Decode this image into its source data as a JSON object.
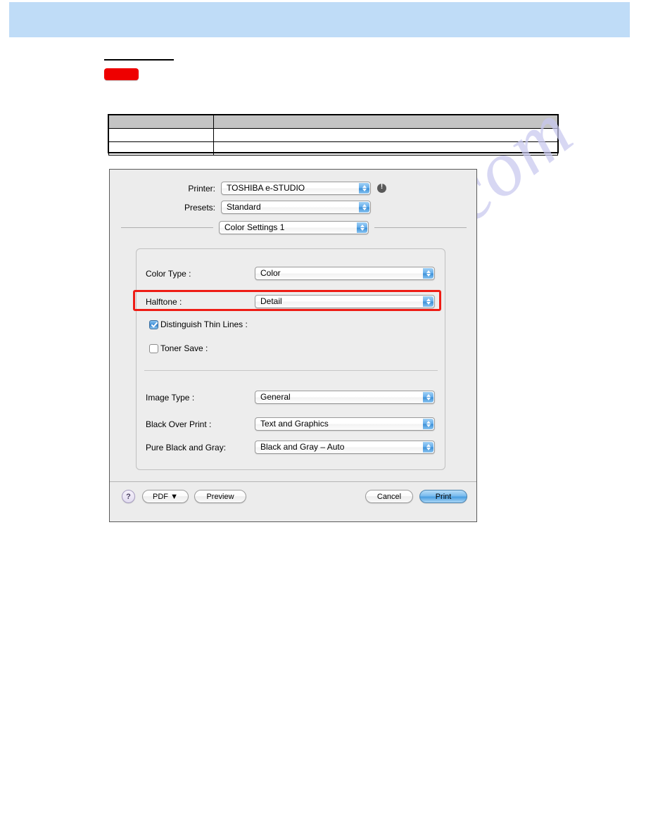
{
  "page": {
    "banner_color": "#bfdcf7",
    "watermark": "manualshive.com"
  },
  "doc_table": {
    "header": [
      "",
      ""
    ],
    "rows": [
      [
        "",
        ""
      ],
      [
        "",
        ""
      ]
    ]
  },
  "dialog": {
    "header": {
      "printer_label": "Printer:",
      "printer_value": "TOSHIBA e-STUDIO",
      "printer_status_icon": "info-icon",
      "presets_label": "Presets:",
      "presets_value": "Standard",
      "pane_value": "Color Settings 1"
    },
    "panel": {
      "color_type_label": "Color Type :",
      "color_type_value": "Color",
      "halftone_label": "Halftone :",
      "halftone_value": "Detail",
      "distinguish_thin_lines_label": "Distinguish Thin Lines :",
      "distinguish_thin_lines_checked": true,
      "toner_save_label": "Toner Save :",
      "toner_save_checked": false,
      "image_type_label": "Image Type :",
      "image_type_value": "General",
      "black_over_print_label": "Black Over Print :",
      "black_over_print_value": "Text and Graphics",
      "pure_black_and_gray_label": "Pure Black and Gray:",
      "pure_black_and_gray_value": "Black and Gray – Auto"
    },
    "footer": {
      "help_label": "?",
      "pdf_label": "PDF ▼",
      "preview_label": "Preview",
      "cancel_label": "Cancel",
      "print_label": "Print"
    },
    "highlight": {
      "target": "halftone-row",
      "color": "#ee1c15"
    }
  }
}
